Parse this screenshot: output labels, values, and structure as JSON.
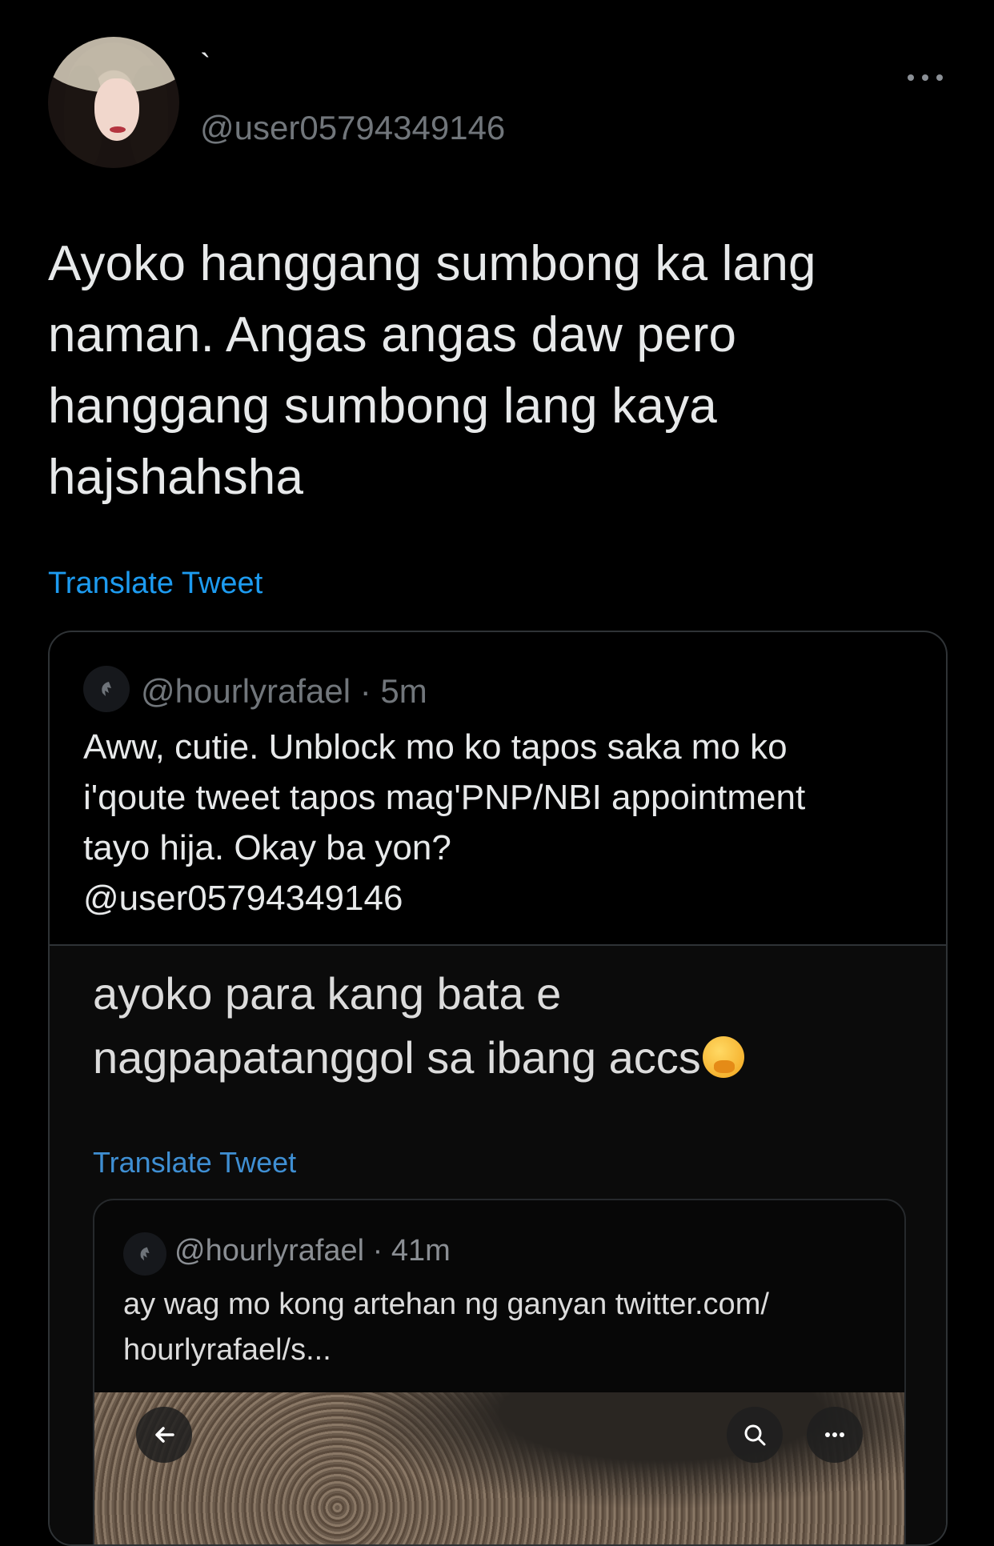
{
  "author": {
    "display_name": "`",
    "handle": "@user05794349146"
  },
  "tweet": {
    "text_lines": [
      "Ayoko hanggang sumbong ka lang",
      "naman. Angas angas daw pero",
      "hanggang sumbong lang kaya",
      "hajshahsha"
    ],
    "translate_label": "Translate Tweet"
  },
  "quoted": {
    "handle": "@hourlyrafael",
    "time": "5m",
    "meta": "@hourlyrafael · 5m",
    "text_lines": [
      "Aww, cutie. Unblock mo ko tapos saka mo ko",
      "i'qoute tweet tapos mag'PNP/NBI appointment",
      "tayo hija. Okay ba yon?",
      "@user05794349146"
    ],
    "screenshot": {
      "text_lines": [
        "ayoko para kang bata e",
        "nagpapatanggol sa ibang accs"
      ],
      "emoji": "face-with-hand-over-mouth",
      "translate_label": "Translate Tweet",
      "inner_quote": {
        "meta": "@hourlyrafael · 41m",
        "text_lines": [
          "ay wag mo kong artehan ng ganyan twitter.com/",
          "hourlyrafael/s..."
        ]
      }
    }
  },
  "colors": {
    "background": "#000000",
    "text": "#e7e9ea",
    "secondary": "#71767b",
    "link": "#1d9bf0",
    "border": "#2f3336"
  }
}
